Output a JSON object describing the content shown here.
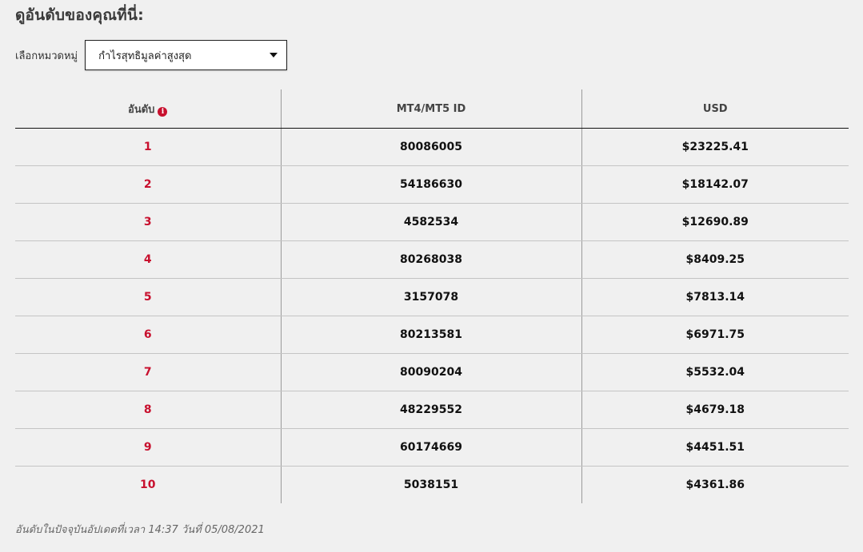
{
  "page": {
    "title": "ดูอันดับของคุณที่นี่:"
  },
  "category": {
    "label": "เลือกหมวดหมู่",
    "selected": "กำไรสุทธิมูลค่าสูงสุด"
  },
  "table": {
    "headers": {
      "rank": "อันดับ",
      "account_id": "MT4/MT5 ID",
      "usd": "USD"
    },
    "rows": [
      {
        "rank": "1",
        "account_id": "80086005",
        "usd": "$23225.41"
      },
      {
        "rank": "2",
        "account_id": "54186630",
        "usd": "$18142.07"
      },
      {
        "rank": "3",
        "account_id": "4582534",
        "usd": "$12690.89"
      },
      {
        "rank": "4",
        "account_id": "80268038",
        "usd": "$8409.25"
      },
      {
        "rank": "5",
        "account_id": "3157078",
        "usd": "$7813.14"
      },
      {
        "rank": "6",
        "account_id": "80213581",
        "usd": "$6971.75"
      },
      {
        "rank": "7",
        "account_id": "80090204",
        "usd": "$5532.04"
      },
      {
        "rank": "8",
        "account_id": "48229552",
        "usd": "$4679.18"
      },
      {
        "rank": "9",
        "account_id": "60174669",
        "usd": "$4451.51"
      },
      {
        "rank": "10",
        "account_id": "5038151",
        "usd": "$4361.86"
      }
    ]
  },
  "footer": {
    "updated_text": "อันดับในปัจจุบันอัปเดตที่เวลา 14:37 วันที่ 05/08/2021"
  },
  "icons": {
    "info": "info-circle-icon",
    "dropdown": "caret-down-icon"
  },
  "colors": {
    "accent": "#c8102e",
    "background": "#f0f0f0"
  }
}
